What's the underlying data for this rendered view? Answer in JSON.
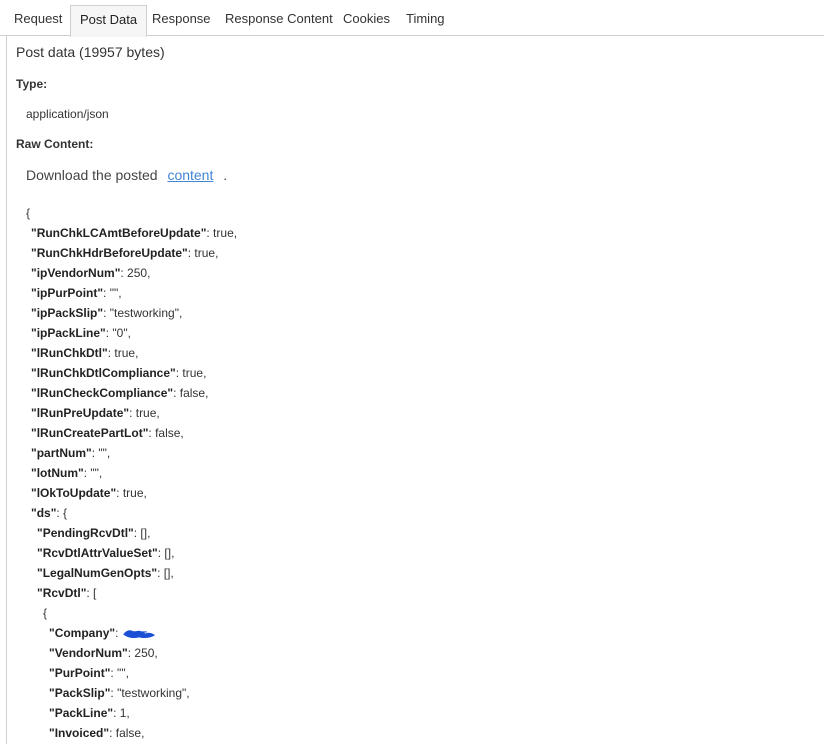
{
  "tabs": [
    {
      "label": "Request"
    },
    {
      "label": "Post Data"
    },
    {
      "label": "Response"
    },
    {
      "label": "Response Content"
    },
    {
      "label": "Cookies"
    },
    {
      "label": "Timing"
    }
  ],
  "active_tab": "Post Data",
  "heading": "Post data (19957 bytes)",
  "type_label": "Type:",
  "type_value": "application/json",
  "raw_label": "Raw Content:",
  "download": {
    "prefix": "Download the posted",
    "link": "content",
    "suffix": "."
  },
  "json_lines": [
    {
      "key": "",
      "value": "{"
    },
    {
      "key": "\"RunChkLCAmtBeforeUpdate\"",
      "value": ": true,"
    },
    {
      "key": "\"RunChkHdrBeforeUpdate\"",
      "value": ": true,"
    },
    {
      "key": "\"ipVendorNum\"",
      "value": ": 250,"
    },
    {
      "key": "\"ipPurPoint\"",
      "value": ": \"\","
    },
    {
      "key": "\"ipPackSlip\"",
      "value": ": \"testworking\","
    },
    {
      "key": "\"ipPackLine\"",
      "value": ": \"0\","
    },
    {
      "key": "\"lRunChkDtl\"",
      "value": ": true,"
    },
    {
      "key": "\"lRunChkDtlCompliance\"",
      "value": ": true,"
    },
    {
      "key": "\"lRunCheckCompliance\"",
      "value": ": false,"
    },
    {
      "key": "\"lRunPreUpdate\"",
      "value": ": true,"
    },
    {
      "key": "\"lRunCreatePartLot\"",
      "value": ": false,"
    },
    {
      "key": "\"partNum\"",
      "value": ": \"\","
    },
    {
      "key": "\"lotNum\"",
      "value": ": \"\","
    },
    {
      "key": "\"lOkToUpdate\"",
      "value": ": true,"
    },
    {
      "key": "\"ds\"",
      "value": ": {"
    },
    {
      "key": "\"PendingRcvDtl\"",
      "value": ": [],"
    },
    {
      "key": "\"RcvDtlAttrValueSet\"",
      "value": ": [],"
    },
    {
      "key": "\"LegalNumGenOpts\"",
      "value": ": [],"
    },
    {
      "key": "\"RcvDtl\"",
      "value": ": ["
    },
    {
      "key": "",
      "value": "{"
    },
    {
      "key": "\"Company\"",
      "value": ":",
      "redacted": true
    },
    {
      "key": "\"VendorNum\"",
      "value": ": 250,"
    },
    {
      "key": "\"PurPoint\"",
      "value": ": \"\","
    },
    {
      "key": "\"PackSlip\"",
      "value": ": \"testworking\","
    },
    {
      "key": "\"PackLine\"",
      "value": ": 1,"
    },
    {
      "key": "\"Invoiced\"",
      "value": ": false,"
    }
  ],
  "colors": {
    "link": "#4285d6",
    "redaction": "#1a4fd6",
    "border": "#cfcfcf",
    "active_tab_bg": "#f6f6f6"
  },
  "icons": {
    "redaction": "scribble-redaction-icon"
  }
}
